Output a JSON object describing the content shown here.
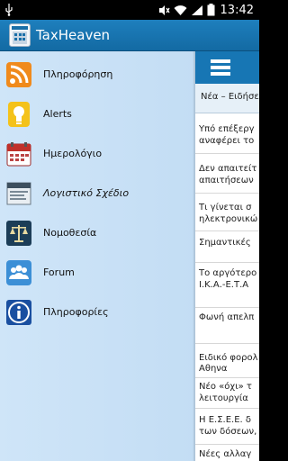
{
  "status_bar": {
    "time": "13:42"
  },
  "app": {
    "title": "TaxHeaven"
  },
  "drawer": {
    "items": [
      {
        "label": "Πληροφόρηση",
        "icon": "rss-icon"
      },
      {
        "label": "Alerts",
        "icon": "lightbulb-icon"
      },
      {
        "label": "Ημερολόγιο",
        "icon": "calendar-icon"
      },
      {
        "label": "Λογιστικό Σχέδιο",
        "icon": "tax-book-icon"
      },
      {
        "label": "Νομοθεσία",
        "icon": "scales-icon"
      },
      {
        "label": "Forum",
        "icon": "users-icon"
      },
      {
        "label": "Πληροφορίες",
        "icon": "info-icon"
      }
    ]
  },
  "content": {
    "tab_label": "Νέα – Ειδήσει",
    "news": [
      {
        "line1": "Υπό επέξεργ",
        "line2": "αναφέρει το"
      },
      {
        "line1": "Δεν απαιτείτ",
        "line2": "απαιτήσεων"
      },
      {
        "line1": "Τι γίνεται σ",
        "line2": "ηλεκτρονικώ"
      },
      {
        "line1": "Σημαντικές",
        "line2": ""
      },
      {
        "line1": "Το αργότερο",
        "line2": "Ι.Κ.Α.-Ε.Τ.Α"
      },
      {
        "line1": "Φωνή απελπ",
        "line2": ""
      },
      {
        "line1": "Ειδικό φορολ",
        "line2": "Αθηνα"
      },
      {
        "line1": "Νέο «όχι» τ",
        "line2": "λειτουργία"
      },
      {
        "line1": "Η Ε.Σ.Ε.Ε. δ",
        "line2": "των δόσεων,"
      },
      {
        "line1": "Νέες αλλαγ",
        "line2": ""
      }
    ]
  },
  "colors": {
    "action_bar": "#1a72ad",
    "drawer_bg": "#c9e1f6"
  }
}
